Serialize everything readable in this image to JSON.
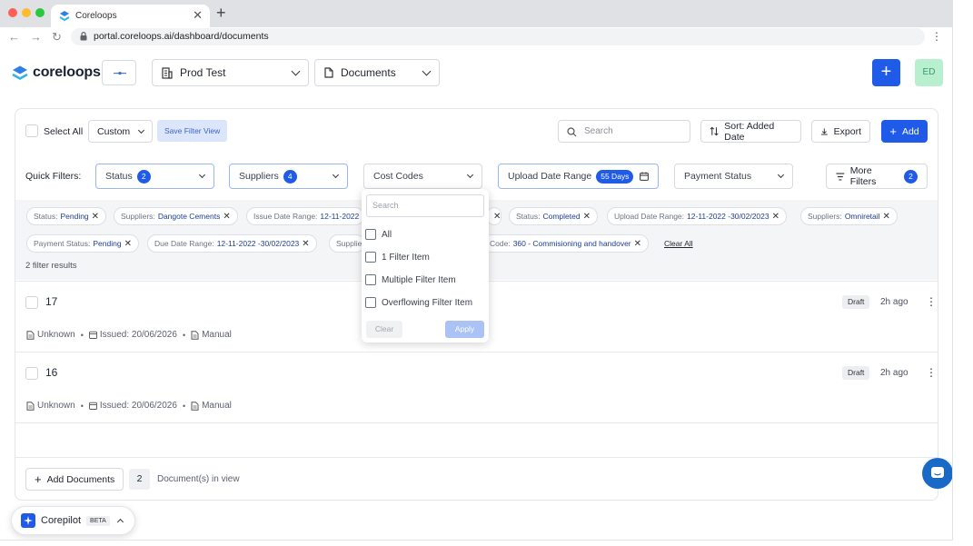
{
  "browser": {
    "tab_title": "Coreloops",
    "url": "portal.coreloops.ai/dashboard/documents"
  },
  "header": {
    "brand": "coreloops",
    "workspace": "Prod Test",
    "section": "Documents",
    "avatar_initials": "ED",
    "accent": "#1f5be8"
  },
  "toolbar": {
    "select_all": "Select All",
    "view": "Custom",
    "save_view": "Save Filter View",
    "search_placeholder": "Search",
    "sort": "Sort: Added Date",
    "export": "Export",
    "add": "Add"
  },
  "quick_filters": {
    "label": "Quick Filters:",
    "status": "Status",
    "status_count": "2",
    "suppliers": "Suppliers",
    "suppliers_count": "4",
    "cost_codes": "Cost Codes",
    "upload_range": "Upload Date Range",
    "upload_badge": "55 Days",
    "payment_status": "Payment Status",
    "more": "More Filters",
    "more_count": "2"
  },
  "chips": [
    {
      "key": "Status:",
      "value": "Pending"
    },
    {
      "key": "Suppliers:",
      "value": "Dangote Cements"
    },
    {
      "key": "Issue Date Range:",
      "value": "12-11-2022"
    },
    {
      "key": "Status:",
      "value": "Completed"
    },
    {
      "key": "Upload Date Range:",
      "value": "12-11-2022 -30/02/2023"
    },
    {
      "key": "Suppliers:",
      "value": "Omniretail"
    },
    {
      "key": "Payment Status:",
      "value": "Pending"
    },
    {
      "key": "Due Date Range:",
      "value": "12-11-2022 -30/02/2023"
    },
    {
      "key": "Supplie",
      "value": ""
    },
    {
      "key": "Code:",
      "value": "360 - Commisioning and handover"
    }
  ],
  "clear_all": "Clear All",
  "results": "2 filter results",
  "documents": [
    {
      "title": "17",
      "type": "Unknown",
      "issued": "Issued: 20/06/2026",
      "source": "Manual",
      "status": "Draft",
      "ago": "2h ago"
    },
    {
      "title": "16",
      "type": "Unknown",
      "issued": "Issued: 20/06/2026",
      "source": "Manual",
      "status": "Draft",
      "ago": "2h ago"
    }
  ],
  "footer": {
    "add_documents": "Add Documents",
    "count": "2",
    "in_view": "Document(s) in view"
  },
  "dropdown": {
    "search_placeholder": "Search",
    "items": [
      "All",
      "1 Filter Item",
      "Multiple Filter Item",
      "Overflowing Filter Item"
    ],
    "clear": "Clear",
    "apply": "Apply"
  },
  "corepilot": {
    "label": "Corepilot",
    "badge": "BETA"
  }
}
